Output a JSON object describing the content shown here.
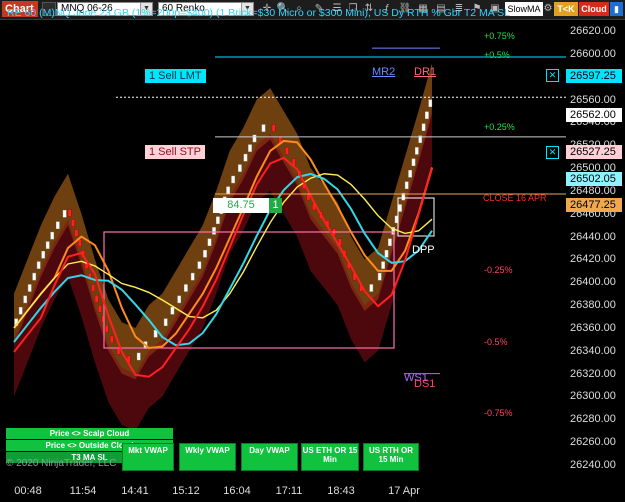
{
  "toolbar": {
    "chart_tab": "Chart",
    "instrument": "MNQ 06-26",
    "period": "60 Renko",
    "slowma": "SlowMA",
    "tck": "T<K",
    "cloud": "Cloud",
    "colors": {
      "cloud": "#d62a1a",
      "tck": "#e0a020",
      "chart_tab": "#c53a1e"
    }
  },
  "header": "RE 60 (M)NQ June 23 GB (1%=200p=$400) (1 Brick=$30 Micro or $300 Mini), US Dy RTH % Gbr T2 MA SL",
  "orders": {
    "sell_lmt": {
      "label": "1 Sell LMT",
      "price": "26597.25",
      "close_icon": "x-close-icon"
    },
    "sell_stp": {
      "label": "1 Sell STP",
      "price": "26527.25",
      "close_icon": "x-close-icon"
    }
  },
  "levels": {
    "mr2": "MR2",
    "dr1": "DR1",
    "dpp": "DPP",
    "ds1": "DS1",
    "ws1": "WS1",
    "close": "CLOSE 16 APR",
    "pos_value": "84.75",
    "pos_qty": "1"
  },
  "percent_labels": [
    "+0.75%",
    "+0.5%",
    "+0.25%",
    "-0.25%",
    "-0.5%",
    "-0.75%"
  ],
  "price_tags": {
    "last": "26562.00",
    "cyan": "26502.05",
    "orange": "26477.25"
  },
  "buttons": {
    "scalp_cloud": "Price <> Scalp Cloud",
    "outside_cloud": "Price <> Outside Cloud",
    "t3_ma_sl": "T3 MA SL",
    "mkt_vwap": "Mkt VWAP",
    "wkly_vwap": "Wkly VWAP",
    "day_vwap": "Day VWAP",
    "us_eth": "US ETH OR 15 Min",
    "us_rth": "US RTH OR 15 Min"
  },
  "copyright": "© 2020 NinjaTrader, LLC",
  "chart_data": {
    "type": "line",
    "title": "",
    "xlabel": "",
    "ylabel": "",
    "ylim": [
      26230,
      26630
    ],
    "y_ticks": [
      26240,
      26260,
      26280,
      26300,
      26320,
      26340,
      26360,
      26380,
      26400,
      26420,
      26440,
      26460,
      26480,
      26500,
      26520,
      26540,
      26560,
      26580,
      26600,
      26620
    ],
    "x_ticks": [
      "00:48",
      "11:54",
      "14:41",
      "15:12",
      "16:04",
      "17:11",
      "18:43",
      "17 Apr"
    ],
    "series": [
      {
        "name": "",
        "values": [
          26360,
          26390,
          26420,
          26445,
          26465,
          26430,
          26390,
          26355,
          26335,
          26330,
          26350,
          26360,
          26380,
          26400,
          26420,
          26450,
          26485,
          26505,
          26530,
          26540,
          26520,
          26500,
          26470,
          26455,
          26440,
          26410,
          26390,
          26400,
          26440,
          26480,
          26520,
          26562
        ]
      }
    ],
    "reference_lines": [
      {
        "name": "1 Sell LMT",
        "value": 26597.25
      },
      {
        "name": "1 Sell STP",
        "value": 26527.25
      },
      {
        "name": "Last",
        "value": 26562.0
      },
      {
        "name": "CLOSE 16 APR",
        "value": 26477.25
      }
    ],
    "grid": false
  }
}
